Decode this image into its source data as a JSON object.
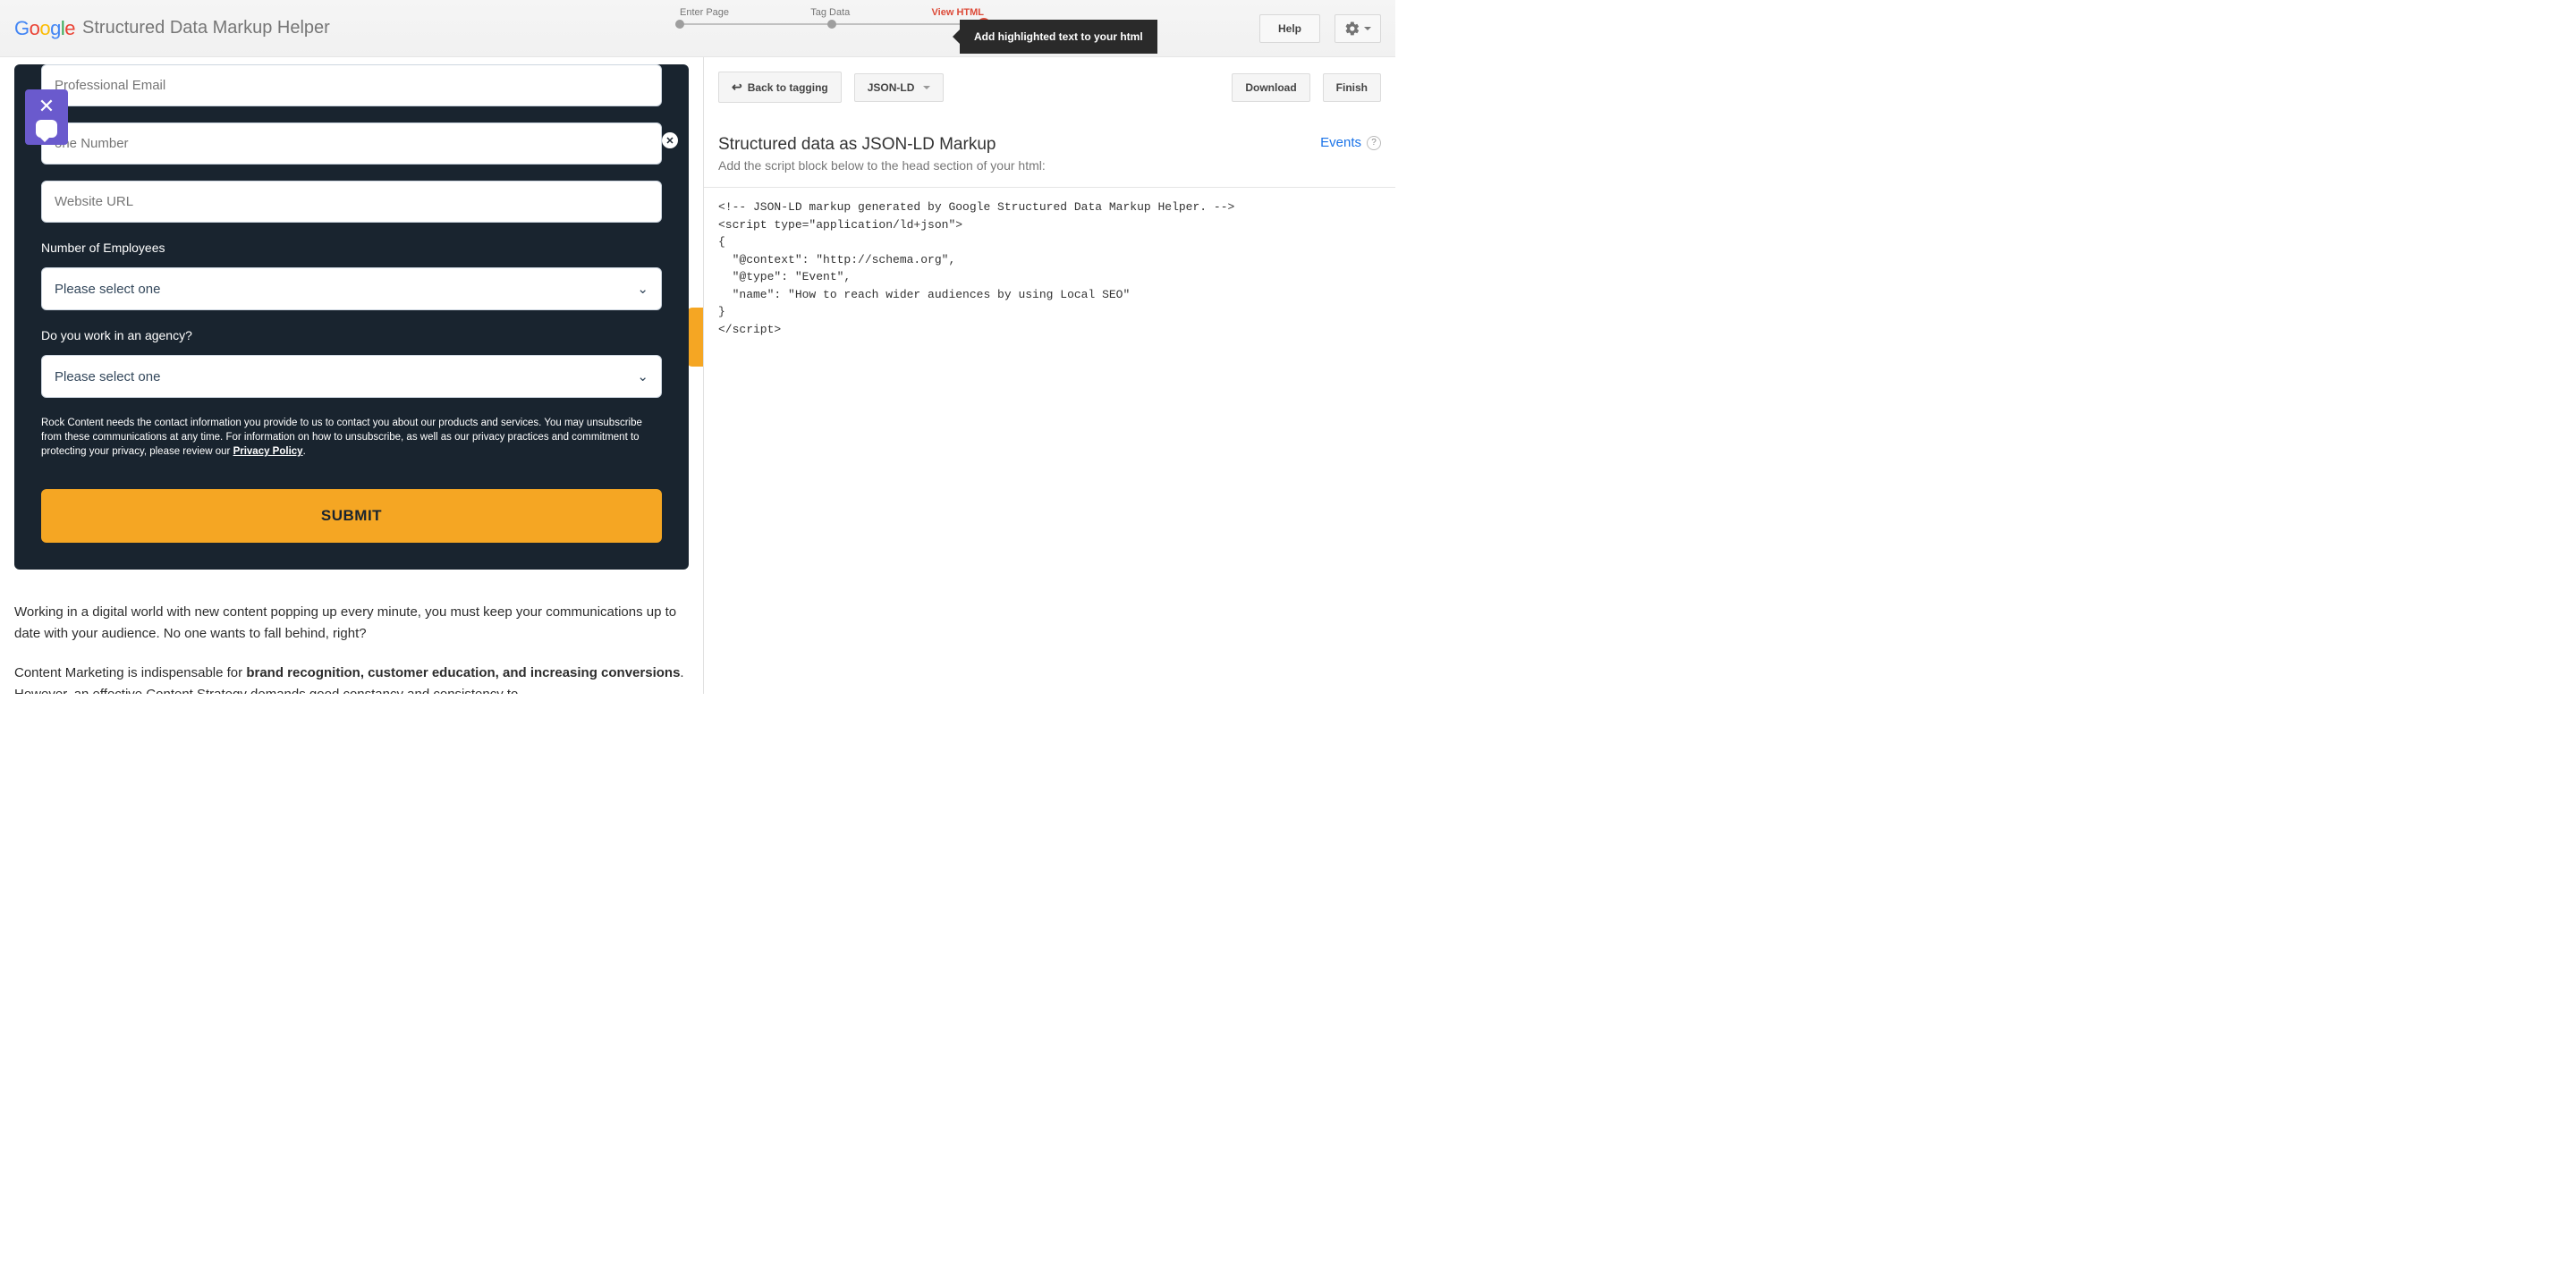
{
  "header": {
    "app_title": "Structured Data Markup Helper",
    "steps": [
      "Enter Page",
      "Tag Data",
      "View HTML"
    ],
    "active_step": 2,
    "tooltip": "Add highlighted text to your html",
    "help_label": "Help"
  },
  "left": {
    "form": {
      "email_placeholder": "Professional Email",
      "phone_placeholder": "one Number",
      "website_placeholder": "Website URL",
      "employees_label": "Number of Employees",
      "employees_value": "Please select one",
      "agency_label": "Do you work in an agency?",
      "agency_value": "Please select one",
      "disclaimer_pre": "Rock Content needs the contact information you provide to us to contact you about our products and services. You may unsubscribe from these communications at any time. For information on how to unsubscribe, as well as our privacy practices and commitment to protecting your privacy, please review our ",
      "privacy_link": "Privacy Policy",
      "disclaimer_post": ".",
      "submit_label": "SUBMIT"
    },
    "article": {
      "p1": "Working in a digital world with new content popping up every minute, you must keep your communications up to date with your audience. No one wants to fall behind, right?",
      "p2_pre": "Content Marketing is indispensable for ",
      "p2_bold": "brand recognition, customer education, and increasing conversions",
      "p2_post": ". However, an effective Content Strategy demands good constancy and consistency to"
    }
  },
  "right": {
    "back_label": "Back to tagging",
    "format_label": "JSON-LD",
    "download_label": "Download",
    "finish_label": "Finish",
    "heading": "Structured data as JSON-LD Markup",
    "subheading": "Add the script block below to the head section of your html:",
    "events_label": "Events",
    "code": "<!-- JSON-LD markup generated by Google Structured Data Markup Helper. -->\n<script type=\"application/ld+json\">\n{\n  \"@context\": \"http://schema.org\",\n  \"@type\": \"Event\",\n  \"name\": \"How to reach wider audiences by using Local SEO\"\n}\n</script>"
  }
}
